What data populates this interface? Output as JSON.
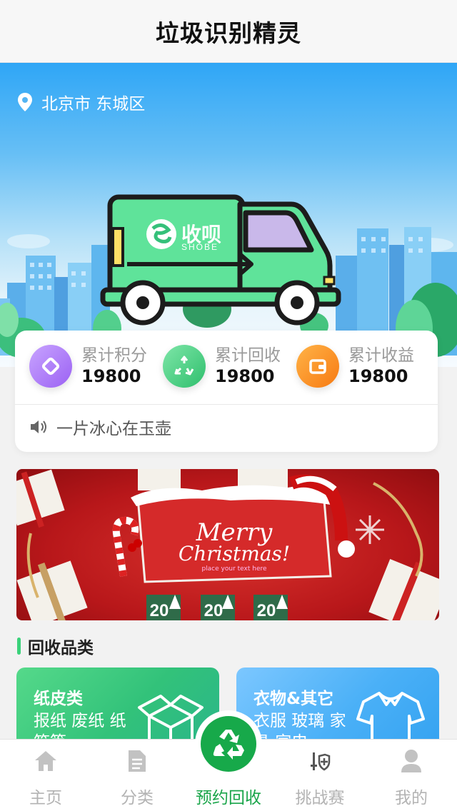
{
  "navbar": {
    "title": "垃圾识别精灵"
  },
  "location": {
    "text": "北京市 东城区"
  },
  "truck": {
    "brand_cn": "收呗",
    "brand_en": "SHOBE"
  },
  "stats": [
    {
      "label": "累计积分",
      "value": "19800",
      "icon": "diamond-icon",
      "color": "#a675f5"
    },
    {
      "label": "累计回收",
      "value": "19800",
      "icon": "recycle-icon",
      "color": "#3ccc7e"
    },
    {
      "label": "累计收益",
      "value": "19800",
      "icon": "wallet-icon",
      "color": "#fb8a1e"
    }
  ],
  "notice": {
    "text": "一片冰心在玉壶"
  },
  "banner": {
    "line1": "Merry",
    "line2": "Christmas!",
    "line3": "place your text here",
    "tags": [
      "20",
      "20",
      "20"
    ]
  },
  "section": {
    "title": "回收品类"
  },
  "categories": [
    {
      "title": "纸皮类",
      "items": "报纸  废纸 纸箱等"
    },
    {
      "title": "衣物&其它",
      "items": "衣服  玻璃 家具 家电"
    }
  ],
  "tabbar": {
    "items": [
      {
        "label": "主页",
        "icon": "home-icon"
      },
      {
        "label": "分类",
        "icon": "document-icon"
      },
      {
        "label": "预约回收",
        "icon": "recycle-icon"
      },
      {
        "label": "挑战赛",
        "icon": "sword-shield-icon"
      },
      {
        "label": "我的",
        "icon": "user-icon"
      }
    ]
  },
  "colors": {
    "accent_green": "#17a94a",
    "hero_blue": "#2fa6f6",
    "truck_green": "#5fe39a"
  }
}
